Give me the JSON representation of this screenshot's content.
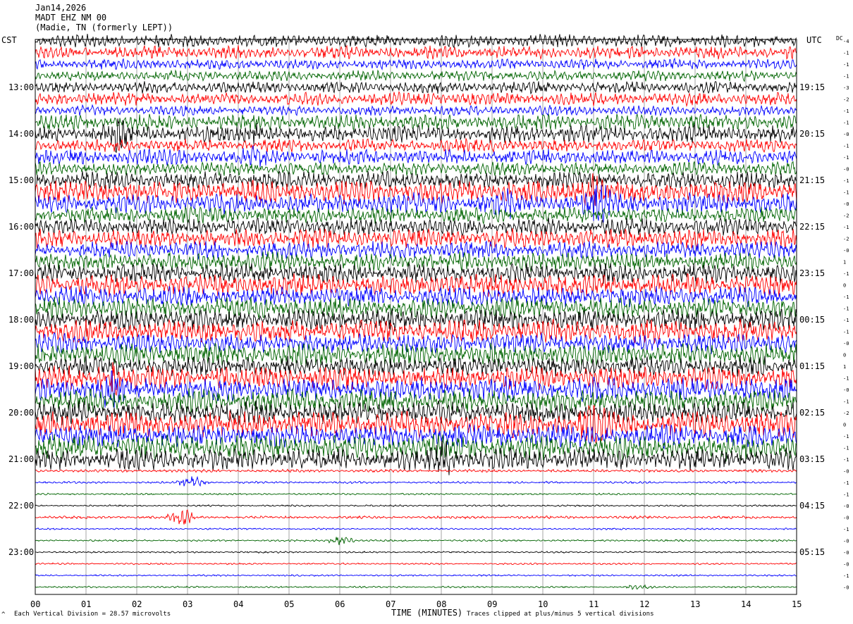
{
  "header": {
    "date": "Jan14,2026",
    "station": "MADT EHZ NM 00",
    "location": "(Madie, TN (formerly LEPT))"
  },
  "labels": {
    "left_tz": "CST",
    "right_tz": "UTC",
    "dc": "DC",
    "xlabel": "TIME (MINUTES)",
    "footer_left": "Each Vertical Division =   28.57 microvolts",
    "footer_right": "Traces clipped at plus/minus 5 vertical divisions",
    "corner_mark": "^"
  },
  "chart_data": {
    "type": "line",
    "title": "MADT EHZ NM 00",
    "xlabel": "TIME (MINUTES)",
    "xlim": [
      0,
      15
    ],
    "x_ticks": [
      "00",
      "01",
      "02",
      "03",
      "04",
      "05",
      "06",
      "07",
      "08",
      "09",
      "10",
      "11",
      "12",
      "13",
      "14",
      "15"
    ],
    "left_time_labels": [
      "13:00",
      "14:00",
      "15:00",
      "16:00",
      "17:00",
      "18:00",
      "19:00",
      "20:00",
      "21:00",
      "22:00",
      "23:00"
    ],
    "right_time_labels": [
      "19:15",
      "20:15",
      "21:15",
      "22:15",
      "23:15",
      "00:15",
      "01:15",
      "02:15",
      "03:15",
      "04:15",
      "05:15"
    ],
    "trace_count": 48,
    "trace_colors": [
      "#000000",
      "#ff0000",
      "#0000ff",
      "#006400"
    ],
    "dc_offsets": [
      "-4",
      "-1",
      "-1",
      "-1",
      "-3",
      "-2",
      "-1",
      "-1",
      "-0",
      "-1",
      "-1",
      "-0",
      "-1",
      "-1",
      "-0",
      "-2",
      "-1",
      "-2",
      "-0",
      "1",
      "-1",
      "0",
      "-1",
      "-1",
      "-1",
      "-1",
      "-0",
      "0",
      "1",
      "-1",
      "-0",
      "-1",
      "-2",
      "0",
      "-1",
      "-1",
      "-1",
      "-0",
      "-1",
      "-1",
      "-0",
      "-0",
      "-1",
      "-0",
      "-0",
      "-0",
      "-1",
      "-0"
    ],
    "amplitude_levels": [
      9,
      9,
      7,
      7,
      8,
      9,
      7,
      11,
      12,
      9,
      11,
      9,
      12,
      16,
      14,
      11,
      12,
      13,
      12,
      13,
      14,
      15,
      14,
      15,
      15,
      16,
      14,
      15,
      14,
      16,
      17,
      16,
      16,
      18,
      16,
      18,
      15,
      2,
      1.5,
      1.2,
      1.2,
      1.8,
      1.2,
      1.3,
      1.2,
      1.2,
      1.2,
      1.2
    ],
    "events": [
      {
        "trace": 8,
        "minute": 1.6,
        "amp": 14
      },
      {
        "trace": 8,
        "minute": 4.3,
        "amp": 8
      },
      {
        "trace": 10,
        "minute": 4.4,
        "amp": 8
      },
      {
        "trace": 13,
        "minute": 11.0,
        "amp": 16
      },
      {
        "trace": 14,
        "minute": 11.1,
        "amp": 22
      },
      {
        "trace": 14,
        "minute": 9.3,
        "amp": 14
      },
      {
        "trace": 29,
        "minute": 1.5,
        "amp": 20
      },
      {
        "trace": 30,
        "minute": 1.5,
        "amp": 16
      },
      {
        "trace": 33,
        "minute": 11.0,
        "amp": 18
      },
      {
        "trace": 36,
        "minute": 8.0,
        "amp": 16
      },
      {
        "trace": 38,
        "minute": 3.1,
        "amp": 9
      },
      {
        "trace": 41,
        "minute": 2.9,
        "amp": 12
      },
      {
        "trace": 43,
        "minute": 6.0,
        "amp": 6
      },
      {
        "trace": 47,
        "minute": 11.9,
        "amp": 3
      }
    ],
    "grid": true
  }
}
